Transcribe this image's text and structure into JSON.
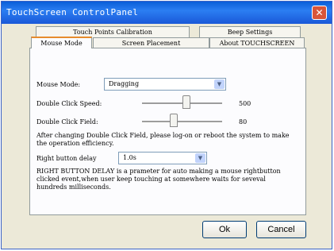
{
  "window": {
    "title": "TouchScreen ControlPanel",
    "close_glyph": "✕"
  },
  "tabs_back": [
    "Touch Points Calibration",
    "Beep Settings"
  ],
  "tabs_front": [
    "Mouse Mode",
    "Screen Placement",
    "About TOUCHSCREEN"
  ],
  "mouse_mode": {
    "label": "Mouse Mode:",
    "value": "Dragging",
    "dbl_speed_label": "Double Click Speed:",
    "dbl_speed_value": "500",
    "dbl_speed_level": 0.55,
    "dbl_field_label": "Double Click Field:",
    "dbl_field_value": "80",
    "dbl_field_level": 0.4,
    "note": "After changing Double Click Field, please log-on or reboot the system to make the operation efficiency.",
    "delay_label": "Right button delay",
    "delay_value": "1.0s",
    "delay_note": "RIGHT BUTTON DELAY is a prameter for auto making a mouse rightbutton clicked event,when user keep touching at somewhere waits for seveval hundreds milliseconds."
  },
  "buttons": {
    "ok": "Ok",
    "cancel": "Cancel"
  },
  "icons": {
    "dropdown": "chevron-down-icon",
    "close": "close-icon"
  }
}
